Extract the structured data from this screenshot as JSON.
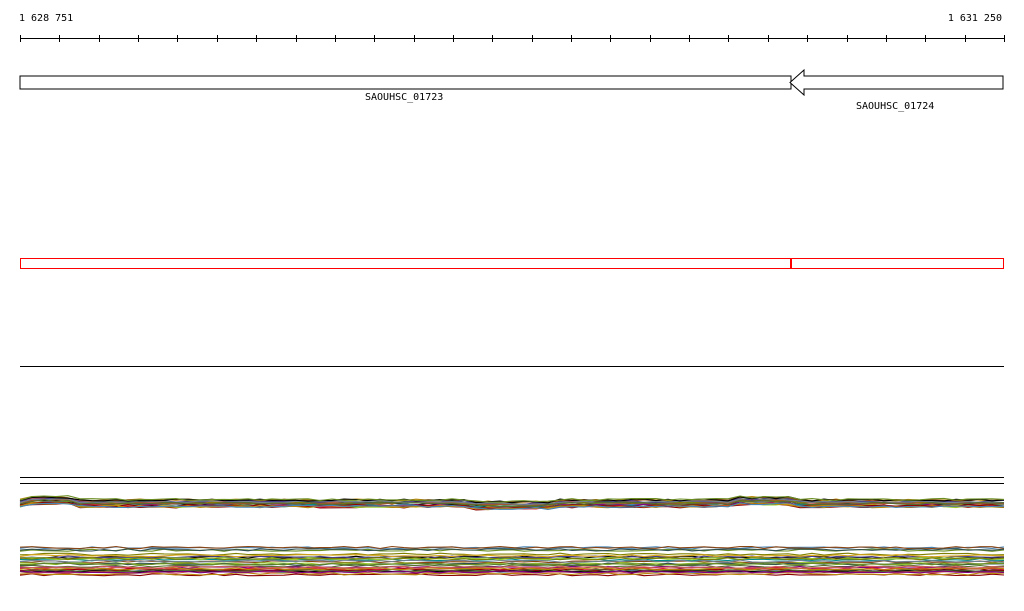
{
  "region": {
    "start_label": "1 628 751",
    "end_label": "1 631 250",
    "start": 1628751,
    "end": 1631250
  },
  "genes": [
    {
      "locus_tag": "SAOUHSC_01723",
      "strand": "-"
    },
    {
      "locus_tag": "SAOUHSC_01724",
      "strand": "-"
    }
  ],
  "colors": {
    "axis": "#000000",
    "gene_outline": "#000000",
    "selection": "#ff0000",
    "track_line": "#000000",
    "coverage_palette": [
      "#000000",
      "#8b0000",
      "#556b2f",
      "#6b8e23",
      "#b8860b",
      "#4682b4",
      "#8b4513",
      "#9acd32",
      "#800080",
      "#2f4f4f",
      "#cd5c5c",
      "#808000",
      "#483d8b",
      "#a0522d",
      "#008b8b",
      "#dc143c",
      "#708090",
      "#daa520"
    ]
  }
}
